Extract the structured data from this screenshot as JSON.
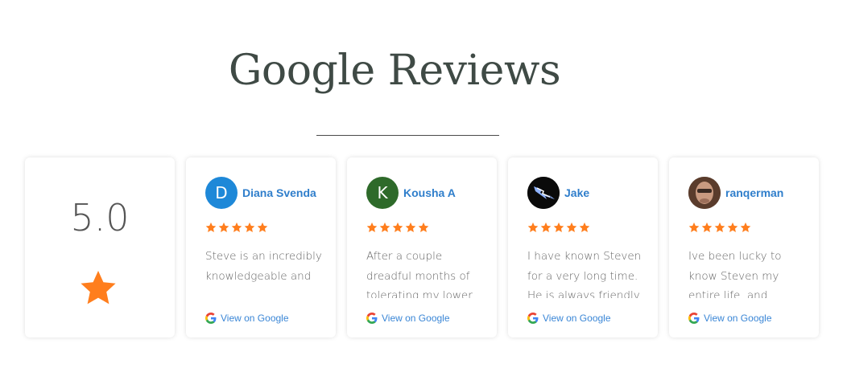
{
  "page": {
    "title": "Google Reviews"
  },
  "summary": {
    "rating": "5.0",
    "star_color": "#ff7e1d"
  },
  "reviews": [
    {
      "name": "Diana Svenda",
      "avatar_letter": "D",
      "avatar_color": "#1e88d8",
      "text": "Steve is an incredibly knowledgeable and",
      "link": "View on Google"
    },
    {
      "name": "Kousha A",
      "avatar_letter": "K",
      "avatar_color": "#2e6a2a",
      "text": "After a couple dreadful months of tolerating my lower",
      "link": "View on Google"
    },
    {
      "name": "Jake",
      "avatar_letter": "",
      "avatar_color": "#0a0a0a",
      "text": "I have known Steven for a very long time. He is always friendly",
      "link": "View on Google"
    },
    {
      "name": "ranqerman",
      "avatar_letter": "",
      "avatar_color": "#6b4a38",
      "text": "Ive been lucky to know Steven my entire life, and",
      "link": "View on Google"
    }
  ],
  "colors": {
    "name": "#2f7ecb",
    "link": "#3a86d6",
    "star": "#ff7e1d"
  }
}
